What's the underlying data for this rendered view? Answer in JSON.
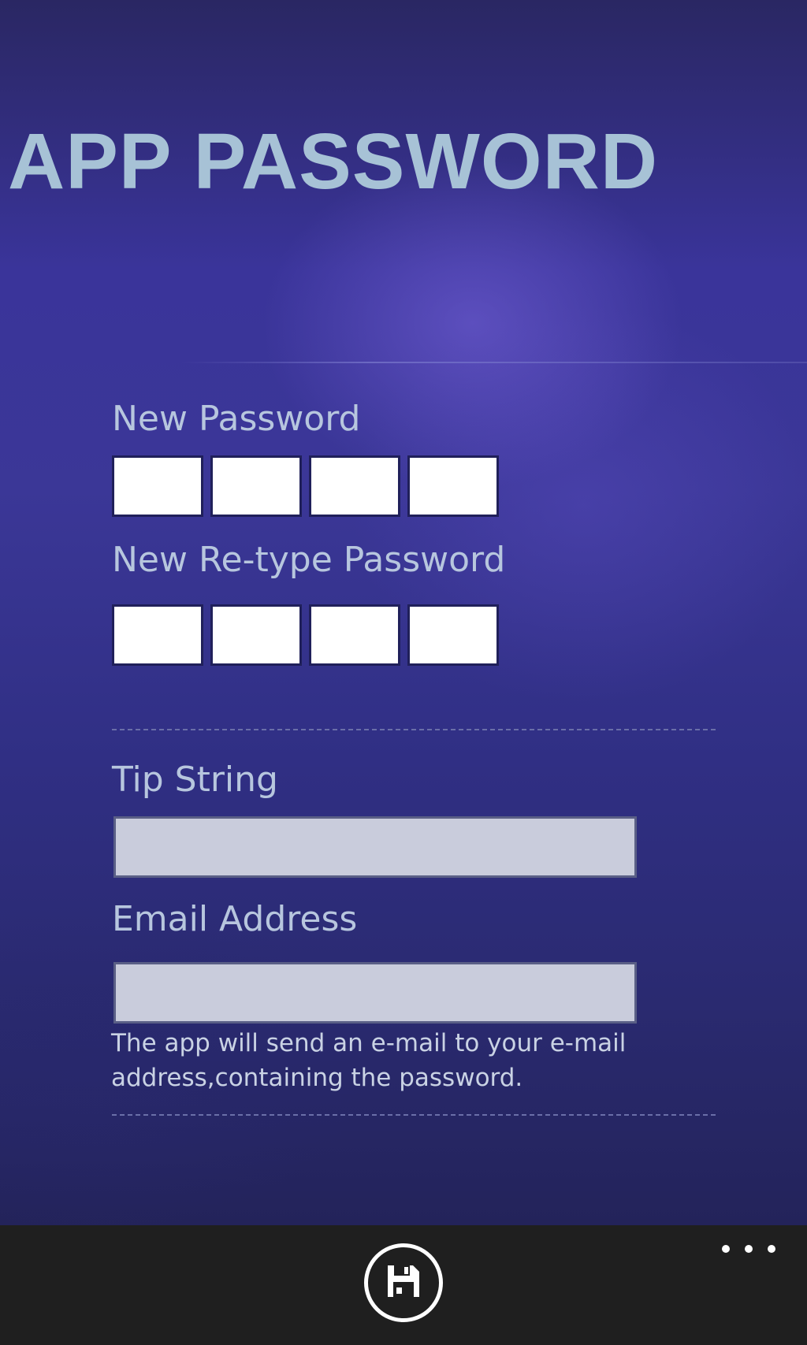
{
  "page": {
    "title": "APP PASSWORD"
  },
  "form": {
    "new_password": {
      "label": "New Password",
      "digits": [
        "",
        "",
        "",
        ""
      ]
    },
    "retype_password": {
      "label": "New Re-type Password",
      "digits": [
        "",
        "",
        "",
        ""
      ]
    },
    "tip_string": {
      "label": "Tip String",
      "value": ""
    },
    "email_address": {
      "label": "Email Address",
      "value": "",
      "help_text": "The app will send an e-mail to your e-mail address,containing the password."
    }
  },
  "app_bar": {
    "save_icon": "save-icon",
    "more_icon": "more-ellipsis-icon"
  },
  "colors": {
    "title": "#a7c2d6",
    "label": "#b7c6de",
    "background": "#3a349a",
    "app_bar": "#1f1f1f"
  }
}
